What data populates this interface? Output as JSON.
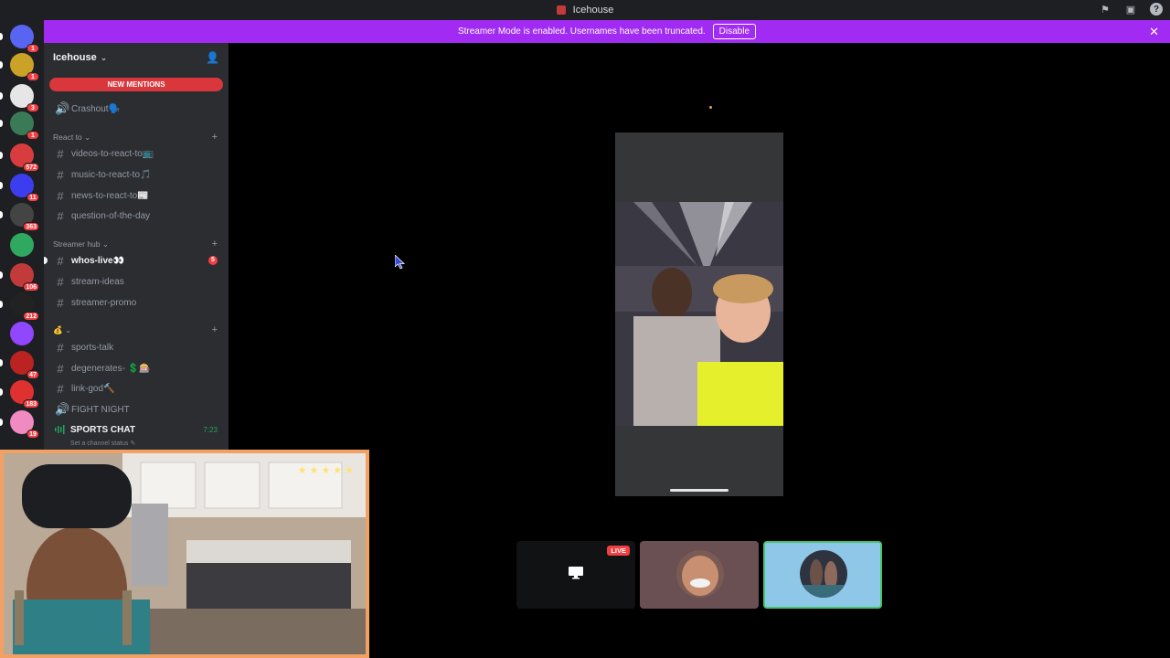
{
  "window": {
    "title": "Icehouse"
  },
  "banner": {
    "message": "Streamer Mode is enabled. Usernames have been truncated.",
    "disable_label": "Disable"
  },
  "rail": {
    "servers": [
      {
        "name": "discord-home",
        "badge": "1",
        "color": "#5865f2"
      },
      {
        "name": "server-2",
        "badge": "1",
        "color": "#c9a227"
      },
      {
        "name": "server-3",
        "badge": "3",
        "color": "#e6e6e6"
      },
      {
        "name": "server-4",
        "badge": "1",
        "color": "#3b7a57"
      },
      {
        "name": "server-5",
        "badge": "572",
        "color": "#d83c3e"
      },
      {
        "name": "server-6",
        "badge": "11",
        "color": "#3d3df0"
      },
      {
        "name": "server-7",
        "badge": "363",
        "color": "#444"
      },
      {
        "name": "server-8",
        "badge": "",
        "color": "#2fa860"
      },
      {
        "name": "server-9",
        "badge": "106",
        "color": "#c23a3a"
      },
      {
        "name": "server-10",
        "badge": "212",
        "color": "#222"
      },
      {
        "name": "server-11",
        "badge": "",
        "color": "#9146ff"
      },
      {
        "name": "server-12",
        "badge": "47",
        "color": "#b22"
      },
      {
        "name": "server-13",
        "badge": "183",
        "color": "#e03131"
      },
      {
        "name": "server-14",
        "badge": "19",
        "color": "#f08ac0"
      }
    ]
  },
  "sidebar": {
    "guild_name": "Icehouse",
    "new_mentions": "NEW MENTIONS",
    "channels_top": [
      {
        "label": "Crashout🗣️",
        "type": "voice"
      }
    ],
    "categories": [
      {
        "name": "React to",
        "channels": [
          {
            "label": "videos-to-react-to📺",
            "type": "text"
          },
          {
            "label": "music-to-react-to🎵",
            "type": "text"
          },
          {
            "label": "news-to-react-to📰",
            "type": "text"
          },
          {
            "label": "question-of-the-day",
            "type": "text"
          }
        ]
      },
      {
        "name": "Streamer hub",
        "channels": [
          {
            "label": "whos-live👀",
            "type": "text",
            "unread": true,
            "badge": "5"
          },
          {
            "label": "stream-ideas",
            "type": "text"
          },
          {
            "label": "streamer-promo",
            "type": "text"
          }
        ]
      },
      {
        "name": "💰",
        "channels": [
          {
            "label": "sports-talk",
            "type": "text"
          },
          {
            "label": "degenerates- 💲🎰",
            "type": "text"
          },
          {
            "label": "link-god🔨",
            "type": "text"
          },
          {
            "label": "FIGHT NIGHT",
            "type": "voice"
          }
        ]
      }
    ],
    "voice_connected": {
      "name": "SPORTS CHAT",
      "time": "7:23",
      "status_placeholder": "Set a channel status ✎"
    }
  },
  "stage": {
    "tiles": [
      {
        "kind": "screen-share",
        "live_label": "LIVE"
      },
      {
        "kind": "user-avatar"
      },
      {
        "kind": "user-avatar",
        "selected": true
      }
    ]
  },
  "webcam": {
    "stars": "★★★★★"
  },
  "colors": {
    "accent_banner": "#a12bf2",
    "mention_red": "#da373c",
    "online_green": "#23a55a",
    "webcam_border": "#f2a064"
  }
}
